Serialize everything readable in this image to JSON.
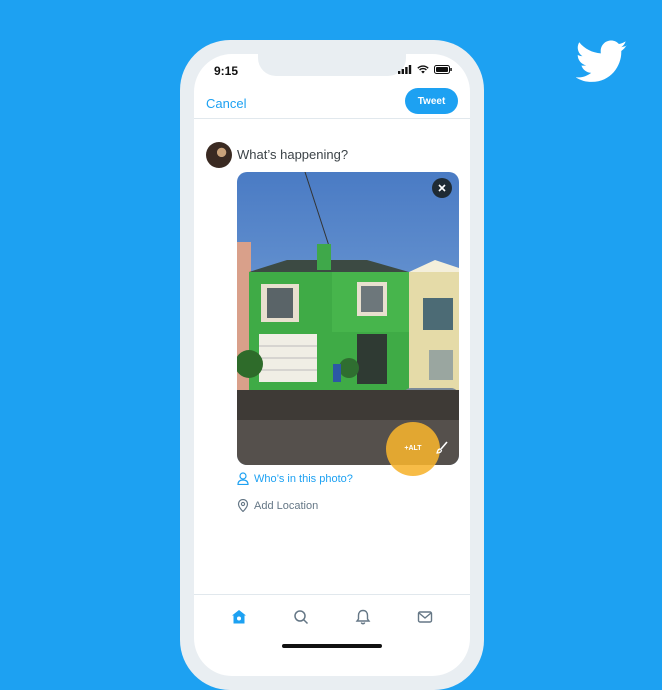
{
  "colors": {
    "accent": "#1da1f2",
    "background": "#1da1f2",
    "alt_highlight": "#f6b32e"
  },
  "status_bar": {
    "time": "9:15"
  },
  "header": {
    "cancel_label": "Cancel",
    "tweet_label": "Tweet"
  },
  "compose": {
    "placeholder": "What’s happening?"
  },
  "media": {
    "alt_label": "+ALT"
  },
  "actions": {
    "tag_label": "Who’s in this photo?",
    "location_label": "Add Location"
  },
  "tabs": [
    {
      "icon": "home-icon",
      "active": true
    },
    {
      "icon": "search-icon",
      "active": false
    },
    {
      "icon": "notifications-icon",
      "active": false
    },
    {
      "icon": "messages-icon",
      "active": false
    }
  ]
}
